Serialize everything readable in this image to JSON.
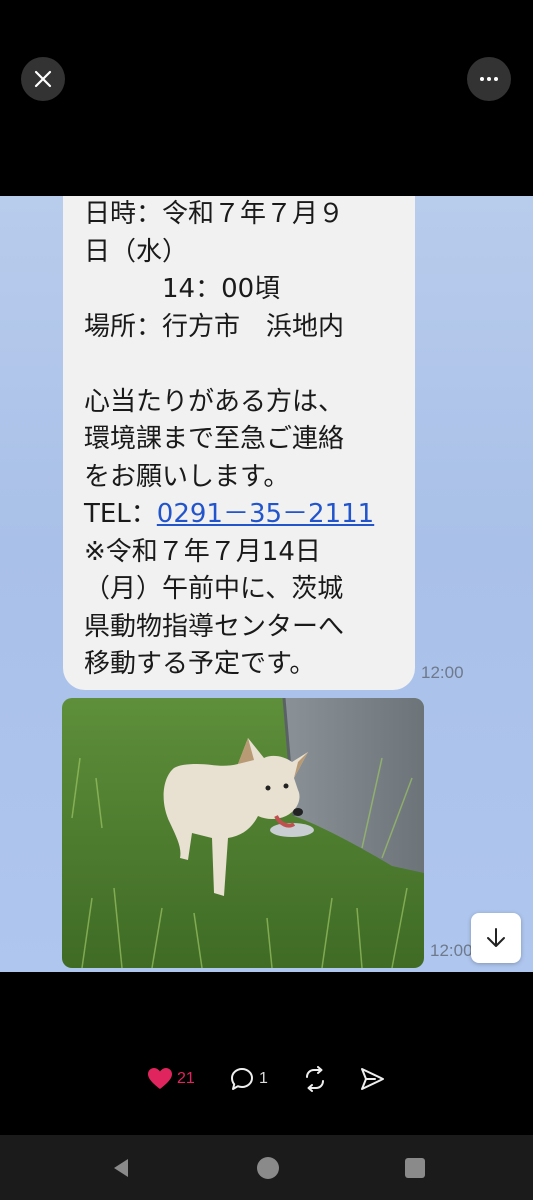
{
  "message": {
    "line1": "日時：令和７年７月９",
    "line2": "日（水）",
    "line3": "　　　14：00頃",
    "line4": "場所：行方市　浜地内",
    "line5": "",
    "line6": "心当たりがある方は、",
    "line7": "環境課まで至急ご連絡",
    "line8": "をお願いします。",
    "tel_label": "TEL：",
    "tel_number": "0291－35－2111",
    "line10": "※令和７年７月14日",
    "line11": "（月）午前中に、茨城",
    "line12": "県動物指導センターへ",
    "line13": "移動する予定です。",
    "time": "12:00"
  },
  "photo": {
    "time": "12:00"
  },
  "actions": {
    "likes": "21",
    "comments": "1"
  },
  "colors": {
    "like": "#e0245e",
    "link": "#2255cc",
    "chat_bg": "#b2c7ec"
  },
  "icons": {
    "close": "close-icon",
    "more": "more-icon",
    "scroll": "arrow-down-icon",
    "like": "heart-icon",
    "comment": "comment-icon",
    "repost": "repost-icon",
    "share": "share-icon",
    "nav_back": "back-triangle-icon",
    "nav_home": "home-circle-icon",
    "nav_recent": "recent-square-icon"
  }
}
